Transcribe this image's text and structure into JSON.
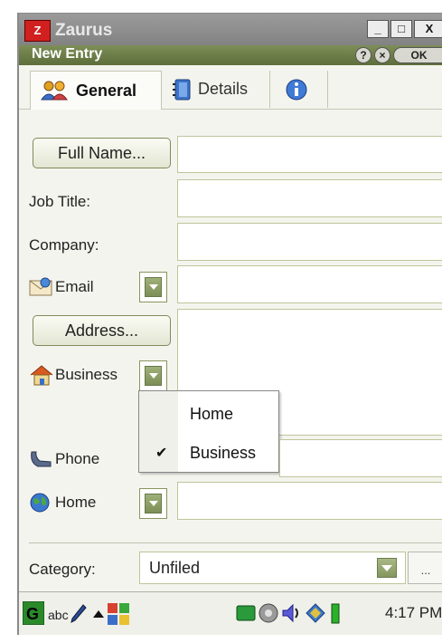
{
  "window": {
    "app_title": "Zaurus",
    "app_icon_text": "Z",
    "minimize_label": "_",
    "maximize_label": "□",
    "close_label": "X",
    "dialog_title": "New Entry",
    "help_label": "?",
    "cancel_label": "×",
    "ok_label": "OK"
  },
  "tabs": [
    {
      "label": "General",
      "icon": "people-icon",
      "active": true
    },
    {
      "label": "Details",
      "icon": "notebook-icon",
      "active": false
    },
    {
      "label": "",
      "icon": "info-icon",
      "active": false
    }
  ],
  "form": {
    "full_name_button": "Full Name...",
    "full_name_value": "",
    "job_title_label": "Job Title:",
    "job_title_value": "",
    "company_label": "Company:",
    "company_value": "",
    "email_label": "Email",
    "email_value": "",
    "address_button": "Address...",
    "address_value": "",
    "business_label": "Business",
    "phone_label": "Phone",
    "phone_value": "",
    "home_label": "Home",
    "home_value": ""
  },
  "address_type_popup": {
    "items": [
      {
        "label": "Home",
        "checked": false
      },
      {
        "label": "Business",
        "checked": true
      }
    ],
    "check_glyph": "✔"
  },
  "category": {
    "label": "Category:",
    "value": "Unfiled",
    "more_label": "..."
  },
  "taskbar": {
    "input_method": "abc",
    "time": "4:17 PM"
  },
  "colors": {
    "title_bar": "#8a8a8a",
    "dialog_bar": "#6b7c45",
    "accent_green": "#8a9b63",
    "field_border": "#bfc59a"
  }
}
